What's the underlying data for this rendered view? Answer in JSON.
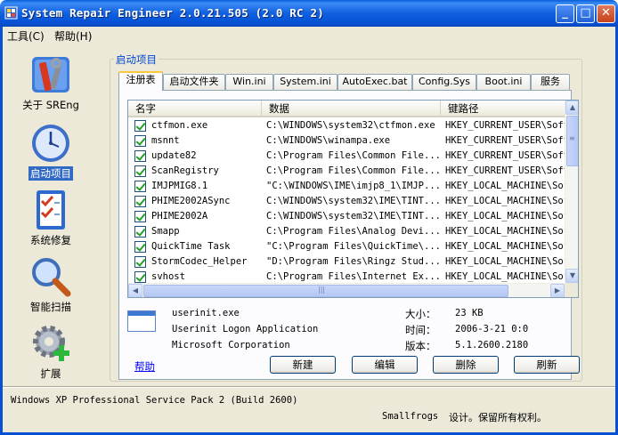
{
  "window": {
    "title": "System Repair Engineer 2.0.21.505 (2.0 RC 2)",
    "controls": {
      "minimize": "_",
      "maximize": "□",
      "close": "✕"
    }
  },
  "menu": {
    "items": [
      "工具(C)",
      "帮助(H)"
    ]
  },
  "sidebar": {
    "items": [
      {
        "label": "关于 SREng",
        "icon": "tools-icon",
        "selected": false
      },
      {
        "label": "启动项目",
        "icon": "clock-icon",
        "selected": true
      },
      {
        "label": "系统修复",
        "icon": "checklist-icon",
        "selected": false
      },
      {
        "label": "智能扫描",
        "icon": "magnifier-icon",
        "selected": false
      },
      {
        "label": "扩展",
        "icon": "gear-plus-icon",
        "selected": false
      }
    ]
  },
  "group": {
    "title": "启动项目"
  },
  "tabs": [
    "注册表",
    "启动文件夹",
    "Win.ini",
    "System.ini",
    "AutoExec.bat",
    "Config.Sys",
    "Boot.ini",
    "服务"
  ],
  "list": {
    "columns": [
      "名字",
      "数据",
      "键路径"
    ],
    "rows": [
      {
        "name": "ctfmon.exe",
        "data": "C:\\WINDOWS\\system32\\ctfmon.exe",
        "key": "HKEY_CURRENT_USER\\Soft",
        "checked": true
      },
      {
        "name": "msnnt",
        "data": "C:\\WINDOWS\\winampa.exe",
        "key": "HKEY_CURRENT_USER\\Soft",
        "checked": true
      },
      {
        "name": "update82",
        "data": "C:\\Program Files\\Common File...",
        "key": "HKEY_CURRENT_USER\\Soft",
        "checked": true
      },
      {
        "name": "ScanRegistry",
        "data": "C:\\Program Files\\Common File...",
        "key": "HKEY_CURRENT_USER\\Soft",
        "checked": true
      },
      {
        "name": "IMJPMIG8.1",
        "data": "\"C:\\WINDOWS\\IME\\imjp8_1\\IMJP...",
        "key": "HKEY_LOCAL_MACHINE\\Sof",
        "checked": true
      },
      {
        "name": "PHIME2002ASync",
        "data": "C:\\WINDOWS\\system32\\IME\\TINT...",
        "key": "HKEY_LOCAL_MACHINE\\Sof",
        "checked": true
      },
      {
        "name": "PHIME2002A",
        "data": "C:\\WINDOWS\\system32\\IME\\TINT...",
        "key": "HKEY_LOCAL_MACHINE\\Sof",
        "checked": true
      },
      {
        "name": "Smapp",
        "data": "C:\\Program Files\\Analog Devi...",
        "key": "HKEY_LOCAL_MACHINE\\Sof",
        "checked": true
      },
      {
        "name": "QuickTime Task",
        "data": "\"C:\\Program Files\\QuickTime\\...",
        "key": "HKEY_LOCAL_MACHINE\\Sof",
        "checked": true
      },
      {
        "name": "StormCodec_Helper",
        "data": "\"D:\\Program Files\\Ringz Stud...",
        "key": "HKEY_LOCAL_MACHINE\\Sof",
        "checked": true
      },
      {
        "name": "svhost",
        "data": "C:\\Program Files\\Internet Ex...",
        "key": "HKEY_LOCAL_MACHINE\\Sof",
        "checked": true
      }
    ],
    "scroll": {
      "up": "▲",
      "down": "▼",
      "left": "◀",
      "right": "▶",
      "grip": "≡",
      "hgrip": "|||"
    }
  },
  "details": {
    "filename": "userinit.exe",
    "description": "Userinit Logon Application",
    "company": "Microsoft Corporation",
    "size_label": "大小：",
    "size": "23 KB",
    "time_label": "时间：",
    "time": "2006-3-21 0:0",
    "version_label": "版本：",
    "version": "5.1.2600.2180"
  },
  "buttons": {
    "help": "帮助",
    "new": "新建",
    "edit": "编辑",
    "delete": "删除",
    "refresh": "刷新"
  },
  "status": {
    "os": "Windows XP Professional Service Pack 2 (Build 2600)",
    "copyright_brand": "Smallfrogs",
    "copyright_text": "设计。保留所有权利。"
  }
}
